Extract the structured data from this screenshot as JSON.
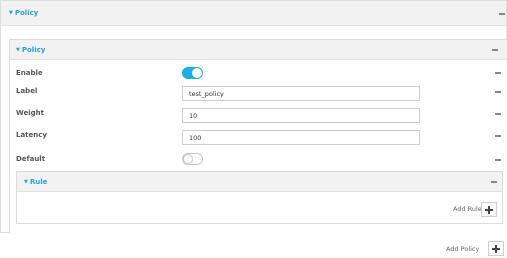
{
  "policy_panel": {
    "title": "Policy",
    "collapse_icon": "caret-down-icon"
  },
  "policy_subpanel": {
    "title": "Policy",
    "collapse_icon": "caret-down-icon"
  },
  "fields": {
    "enable": {
      "label": "Enable",
      "state": true
    },
    "label": {
      "label": "Label",
      "value": "test_policy"
    },
    "weight": {
      "label": "Weight",
      "value": "10"
    },
    "latency": {
      "label": "Latency",
      "value": "100"
    },
    "default": {
      "label": "Default",
      "state": false
    }
  },
  "rule_panel": {
    "title": "Rule",
    "collapse_icon": "caret-down-icon"
  },
  "add_rule": {
    "label": "Add Rule",
    "icon": "plus-icon"
  },
  "add_policy": {
    "label": "Add Policy",
    "icon": "plus-icon"
  },
  "row_action_icon": "minus-icon",
  "colors": {
    "accent": "#2aa1d6",
    "toggle_on": "#19b0ea",
    "header_bg": "#f2f2f2"
  }
}
